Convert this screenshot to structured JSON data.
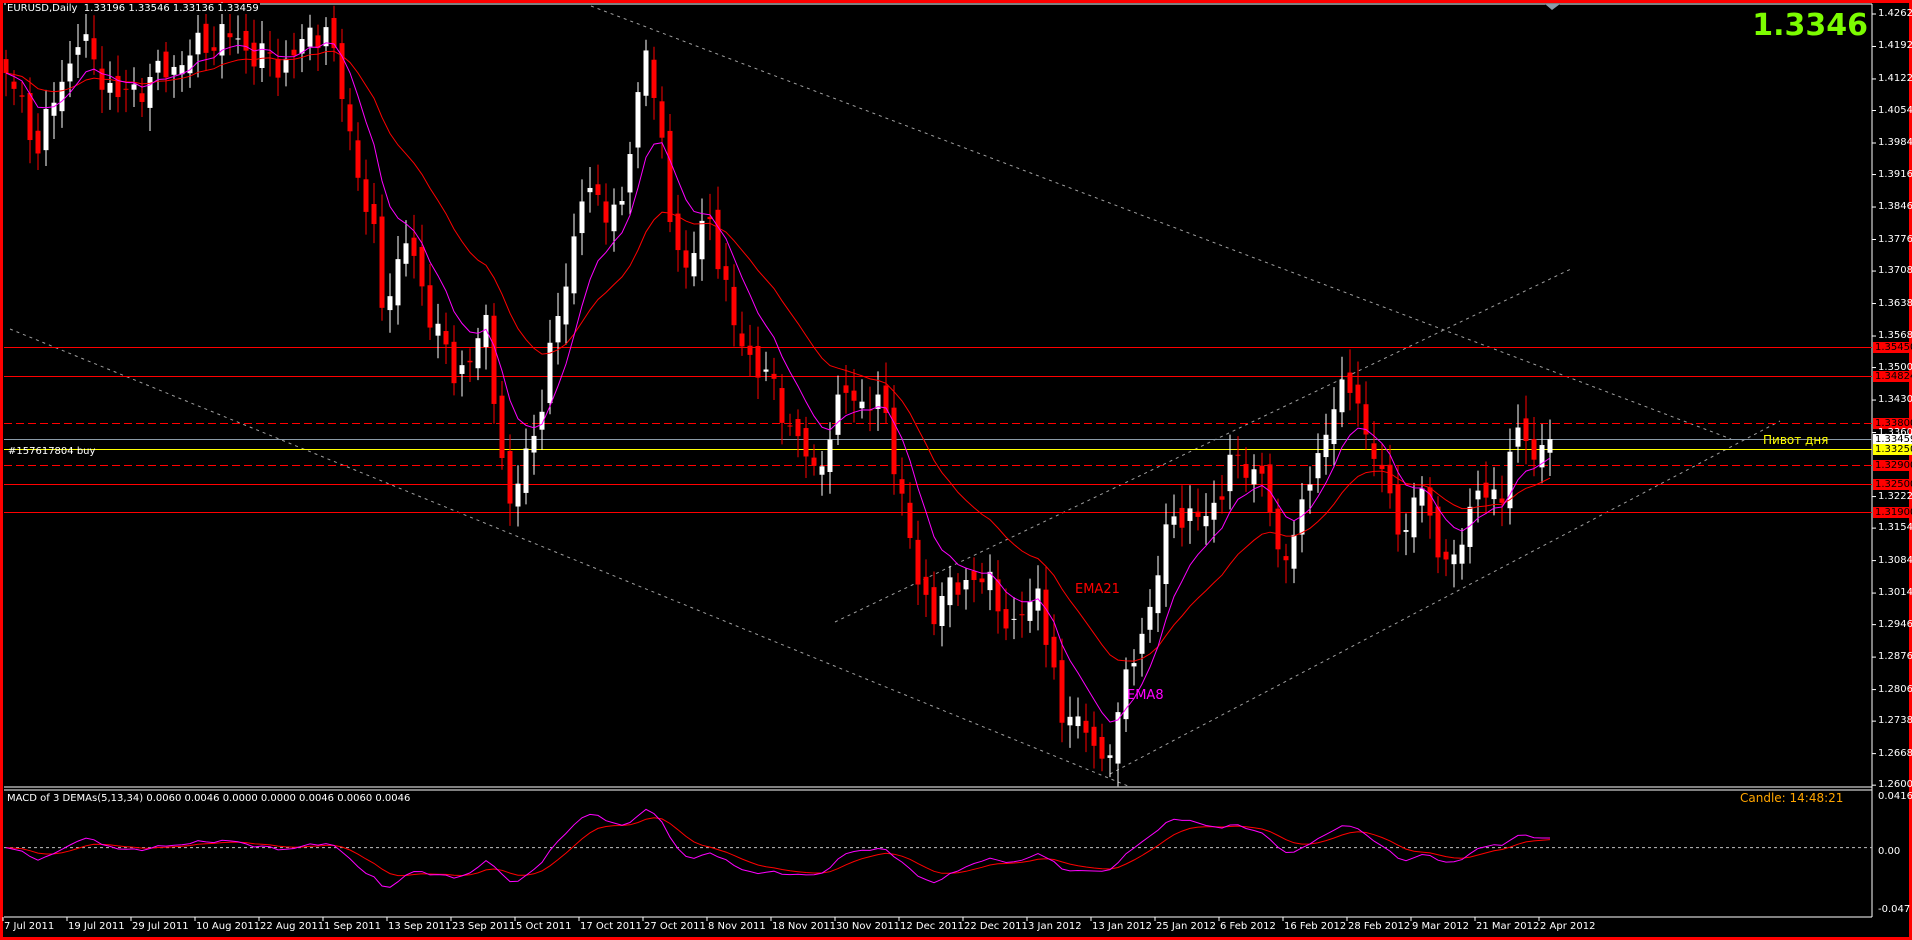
{
  "header": {
    "symbol": "EURUSD,Daily",
    "ohlc": "1.33196 1.33546 1.33136 1.33459"
  },
  "current_price_big": "1.3346",
  "order_label": "#157617804 buy",
  "pivot_label": "Пивот дня",
  "ema_labels": {
    "ema21": "EMA21",
    "ema8": "EMA8"
  },
  "macd": {
    "title": "MACD of 3 DEMAs(5,13,34) 0.0060 0.0046 0.0000 0.0000 0.0046 0.0060 0.0046",
    "timer": "Candle:  14:48:21",
    "axis": [
      "0.0416",
      "0.00",
      "-0.047"
    ],
    "range": [
      -0.047,
      0.0416
    ]
  },
  "colors": {
    "bull": "#ffffff",
    "bear": "#ff0000",
    "ema8": "#ff00ff",
    "ema21": "#ff0000",
    "frame": "#ff0000",
    "big_price": "#7cfc00",
    "pivot": "#ffff00",
    "timer": "#ffa500"
  },
  "price_axis": [
    "1.42622",
    "1.41922",
    "1.41222",
    "1.40542",
    "1.39842",
    "1.39162",
    "1.38462",
    "1.37762",
    "1.37082",
    "1.36382",
    "1.35682",
    "1.35002",
    "1.34302",
    "1.33602",
    "1.32222",
    "1.31542",
    "1.30842",
    "1.30142",
    "1.29462",
    "1.28762",
    "1.28062",
    "1.27382",
    "1.26682",
    "1.26002"
  ],
  "levels": [
    {
      "price": "1.35450",
      "color": "#ff0000",
      "style": "solid",
      "badge": "red"
    },
    {
      "price": "1.34824",
      "color": "#ff0000",
      "style": "solid",
      "badge": "red"
    },
    {
      "price": "1.33800",
      "color": "#ff0000",
      "style": "dash",
      "badge": "red"
    },
    {
      "price": "1.33459",
      "color": "#8a9aa8",
      "style": "solid",
      "badge": "white"
    },
    {
      "price": "1.33250",
      "color": "#ffff00",
      "style": "solid",
      "badge": "yellow"
    },
    {
      "price": "1.32900",
      "color": "#ff0000",
      "style": "dash",
      "badge": "red"
    },
    {
      "price": "1.32500",
      "color": "#ff0000",
      "style": "solid",
      "badge": "red"
    },
    {
      "price": "1.31900",
      "color": "#ff0000",
      "style": "solid",
      "badge": "red"
    }
  ],
  "date_axis": [
    "7 Jul 2011",
    "19 Jul 2011",
    "29 Jul 2011",
    "10 Aug 2011",
    "22 Aug 2011",
    "1 Sep 2011",
    "13 Sep 2011",
    "23 Sep 2011",
    "5 Oct 2011",
    "17 Oct 2011",
    "27 Oct 2011",
    "8 Nov 2011",
    "18 Nov 2011",
    "30 Nov 2011",
    "12 Dec 2011",
    "22 Dec 2011",
    "3 Jan 2012",
    "13 Jan 2012",
    "25 Jan 2012",
    "6 Feb 2012",
    "16 Feb 2012",
    "28 Feb 2012",
    "9 Mar 2012",
    "21 Mar 2012",
    "2 Apr 2012"
  ],
  "price_path": [
    [
      0,
      1.4135
    ],
    [
      4,
      1.398
    ],
    [
      9,
      1.421
    ],
    [
      14,
      1.408
    ],
    [
      20,
      1.414
    ],
    [
      27,
      1.422
    ],
    [
      34,
      1.415
    ],
    [
      40,
      1.424
    ],
    [
      46,
      1.377
    ],
    [
      47,
      1.3635
    ],
    [
      50,
      1.377
    ],
    [
      56,
      1.348
    ],
    [
      60,
      1.358
    ],
    [
      63,
      1.319
    ],
    [
      67,
      1.343
    ],
    [
      72,
      1.387
    ],
    [
      77,
      1.384
    ],
    [
      80,
      1.421
    ],
    [
      83,
      1.383
    ],
    [
      85,
      1.371
    ],
    [
      88,
      1.383
    ],
    [
      91,
      1.358
    ],
    [
      96,
      1.345
    ],
    [
      101,
      1.327
    ],
    [
      105,
      1.345
    ],
    [
      110,
      1.34
    ],
    [
      114,
      1.303
    ],
    [
      116,
      1.298
    ],
    [
      120,
      1.305
    ],
    [
      123,
      1.303
    ],
    [
      126,
      1.293
    ],
    [
      129,
      1.303
    ],
    [
      132,
      1.272
    ],
    [
      133,
      1.278
    ],
    [
      137,
      1.2641
    ],
    [
      139,
      1.276
    ],
    [
      142,
      1.293
    ],
    [
      146,
      1.319
    ],
    [
      150,
      1.317
    ],
    [
      153,
      1.329
    ],
    [
      157,
      1.328
    ],
    [
      159,
      1.308
    ],
    [
      162,
      1.319
    ],
    [
      166,
      1.343
    ],
    [
      169,
      1.345
    ],
    [
      170,
      1.335
    ],
    [
      173,
      1.322
    ],
    [
      175,
      1.314
    ],
    [
      177,
      1.325
    ],
    [
      179,
      1.311
    ],
    [
      181,
      1.306
    ],
    [
      183,
      1.322
    ],
    [
      187,
      1.322
    ],
    [
      188,
      1.335
    ],
    [
      191,
      1.332
    ],
    [
      193,
      1.3346
    ]
  ]
}
